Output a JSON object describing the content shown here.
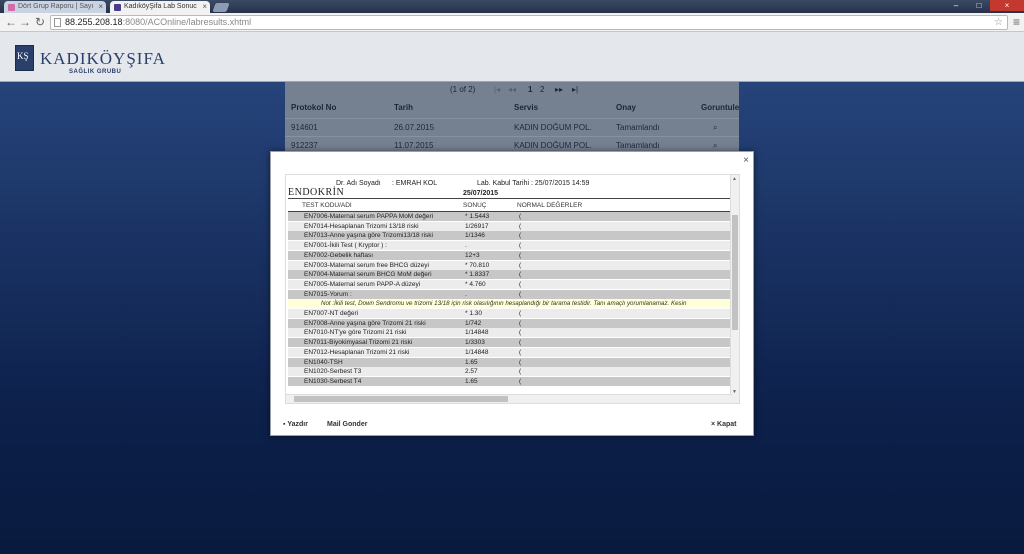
{
  "browser": {
    "tabs": [
      {
        "label": "Dört Grup Raporu | Sayı",
        "active": false
      },
      {
        "label": "KadıköyŞifa Lab Sonuc",
        "active": true
      }
    ],
    "url_host": "88.255.208.18",
    "url_port": ":8080",
    "url_path": "/ACOnline/labresults.xhtml"
  },
  "site": {
    "logo_text": "KADIKÖYŞIFA",
    "logo_sub": "SAĞLIK GRUBU"
  },
  "results": {
    "paginator": {
      "summary": "(1 of 2)",
      "first": "|◂",
      "prev": "◂◂",
      "page1": "1",
      "page2": "2",
      "next": "▸▸",
      "last": "▸|"
    },
    "headers": {
      "protocol": "Protokol No",
      "date": "Tarih",
      "service": "Servis",
      "status": "Onay",
      "view": "Goruntule"
    },
    "rows": [
      {
        "protocol": "914601",
        "date": "26.07.2015",
        "service": "KADIN DOĞUM POL.",
        "status": "Tamamlandı"
      },
      {
        "protocol": "912237",
        "date": "11.07.2015",
        "service": "KADIN DOĞUM POL.",
        "status": "Tamamlandı"
      }
    ]
  },
  "report": {
    "doctor_label": "Dr. Adı Soyadı",
    "doctor_value": ": EMRAH KOL",
    "accept_label": "Lab. Kabul Tarihi",
    "accept_value": ": 25/07/2015 14:59",
    "section": "ENDOKRİN",
    "section_date": "25/07/2015",
    "col_test": "TEST KODU/ADI",
    "col_result": "SONUÇ",
    "col_normal": "NORMAL DEĞERLER",
    "rows_a": [
      {
        "name": "EN7006-Maternal serum PAPPA MoM değeri",
        "result": "* 1.5443",
        "normal": "("
      },
      {
        "name": "EN7014-Hesaplanan Trizomi 13/18 riski",
        "result": "1/26917",
        "normal": "("
      },
      {
        "name": "EN7013-Anne yaşına göre Trizomi13/18 riski",
        "result": "1/1346",
        "normal": "("
      },
      {
        "name": "EN7001-İkili Test ( Kryptor ) :",
        "result": ".",
        "normal": "("
      },
      {
        "name": "EN7002-Gebelik haftası",
        "result": "12+3",
        "normal": "("
      },
      {
        "name": "EN7003-Maternal serum free BHCG düzeyi",
        "result": "* 70.810",
        "normal": "("
      },
      {
        "name": "EN7004-Maternal serum BHCG MoM değeri",
        "result": "* 1.8337",
        "normal": "("
      },
      {
        "name": "EN7005-Maternal serum PAPP-A düzeyi",
        "result": "* 4.760",
        "normal": "("
      },
      {
        "name": "EN7015-Yorum :",
        "result": ".",
        "normal": "("
      }
    ],
    "note": "Not :İkili test, Down Sendromu ve trizomi 13/18 için risk olasılığının hesaplandığı bir tarama testidir. Tanı amaçlı yorumlanamaz. Kesin",
    "rows_b": [
      {
        "name": "EN7007-NT değeri",
        "result": "* 1.30",
        "normal": "("
      },
      {
        "name": "EN7008-Anne yaşına göre Trizomi 21 riski",
        "result": "1/742",
        "normal": "("
      },
      {
        "name": "EN7010-NT'ye göre Trizomi 21 riski",
        "result": "1/14848",
        "normal": "("
      },
      {
        "name": "EN7011-Biyokimyasal Trizomi 21 riski",
        "result": "1/3303",
        "normal": "("
      },
      {
        "name": "EN7012-Hesaplanan Trizomi 21 riski",
        "result": "1/14848",
        "normal": "("
      },
      {
        "name": "EN1040-TSH",
        "result": "1.65",
        "normal": "("
      },
      {
        "name": "EN1020-Serbest T3",
        "result": "2.57",
        "normal": "("
      },
      {
        "name": "EN1030-Serbest T4",
        "result": "1.65",
        "normal": "("
      }
    ]
  },
  "dialog": {
    "print_label": "Yazdır",
    "mail_label": "Mail Gonder",
    "close_label": "Kapat"
  }
}
